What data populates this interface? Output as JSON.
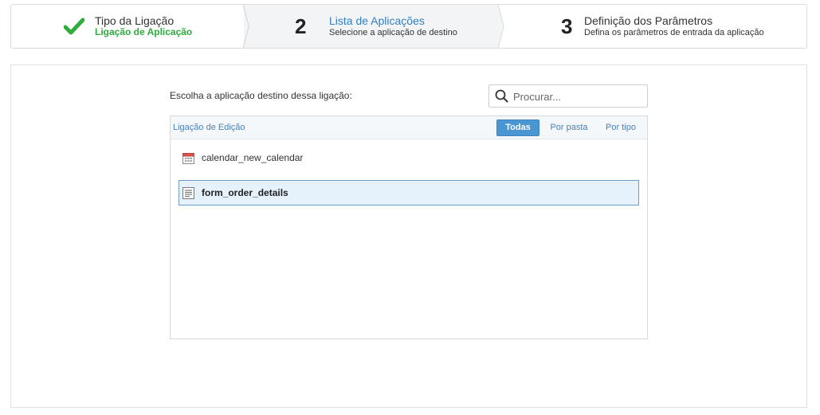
{
  "wizard": {
    "steps": [
      {
        "marker_icon": "check-icon",
        "title": "Tipo da Ligação",
        "subtitle": "Ligação de Aplicação",
        "status": "completed",
        "accent": "#2eac3c"
      },
      {
        "marker": "2",
        "title": "Lista de Aplicações",
        "subtitle": "Selecione a aplicação de destino",
        "status": "active",
        "accent": "#2f7fc1"
      },
      {
        "marker": "3",
        "title": "Definição dos Parâmetros",
        "subtitle": "Defina os parâmetros de entrada da aplicação",
        "status": "pending"
      }
    ]
  },
  "main": {
    "choose_label": "Escolha a aplicação destino dessa ligação:",
    "search": {
      "icon": "search-icon",
      "placeholder": "Procurar...",
      "value": ""
    },
    "list": {
      "header_title": "Ligação de Edição",
      "filters": [
        {
          "label": "Todas",
          "active": true
        },
        {
          "label": "Por pasta",
          "active": false
        },
        {
          "label": "Por tipo",
          "active": false
        }
      ],
      "items": [
        {
          "icon": "calendar-icon",
          "label": "calendar_new_calendar",
          "selected": false
        },
        {
          "icon": "form-icon",
          "label": "form_order_details",
          "selected": true
        }
      ]
    }
  }
}
